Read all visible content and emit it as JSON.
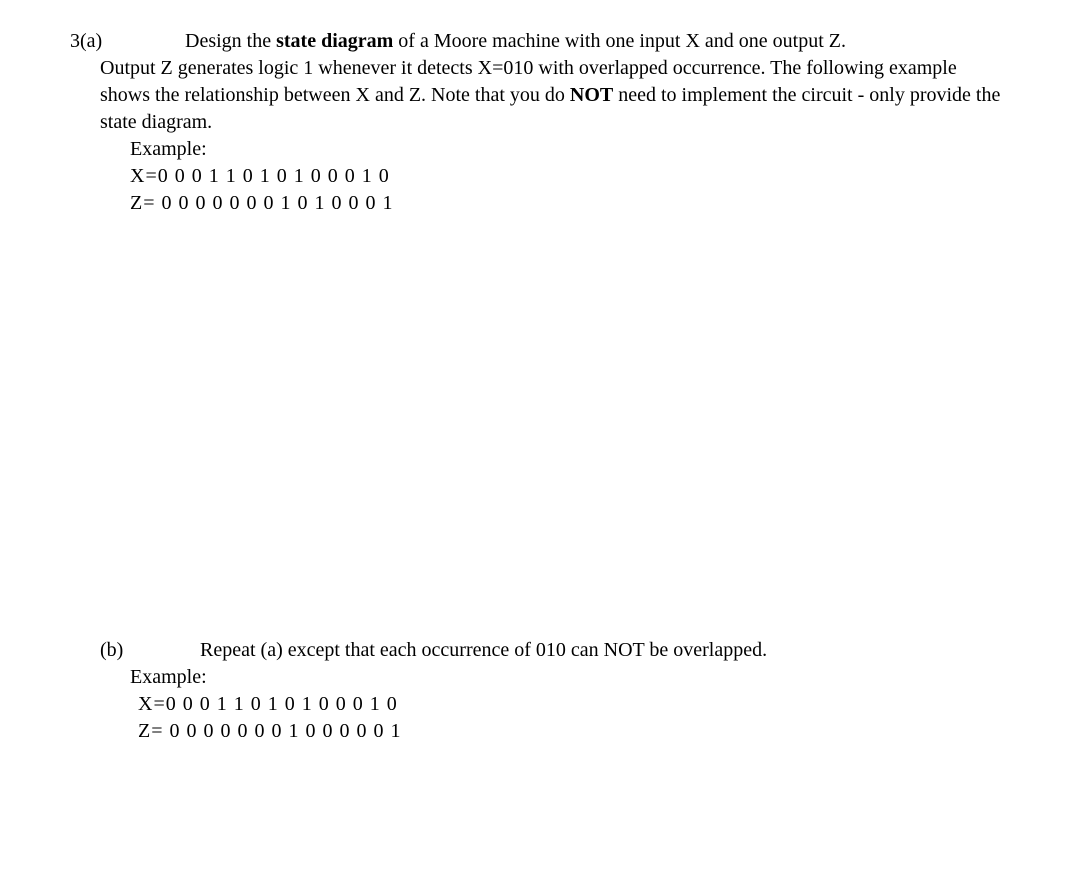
{
  "partA": {
    "label": "3(a)",
    "line1_pre": "Design the ",
    "line1_bold": "state diagram",
    "line1_post": " of a Moore machine with one input X and one output Z.",
    "body_pre": "Output Z generates logic 1 whenever it detects X=010 with overlapped occurrence. The following example shows the relationship between X and Z. Note that you do ",
    "body_bold": "NOT",
    "body_post": " need to implement the circuit - only provide the state diagram.",
    "example_label": "Example:",
    "x_seq": "X=0 0 0 1 1 0 1 0 1 0 0 0 1 0",
    "z_seq": "Z= 0 0 0 0 0 0 0 1 0 1 0 0 0 1"
  },
  "partB": {
    "label": "(b)",
    "line1": "Repeat (a) except that each occurrence of 010 can NOT be overlapped.",
    "example_label": "Example:",
    "x_seq": "X=0 0 0 1 1 0 1 0 1 0 0 0 1 0",
    "z_seq": "Z= 0 0 0 0 0 0 0 1 0 0 0 0 0 1"
  }
}
